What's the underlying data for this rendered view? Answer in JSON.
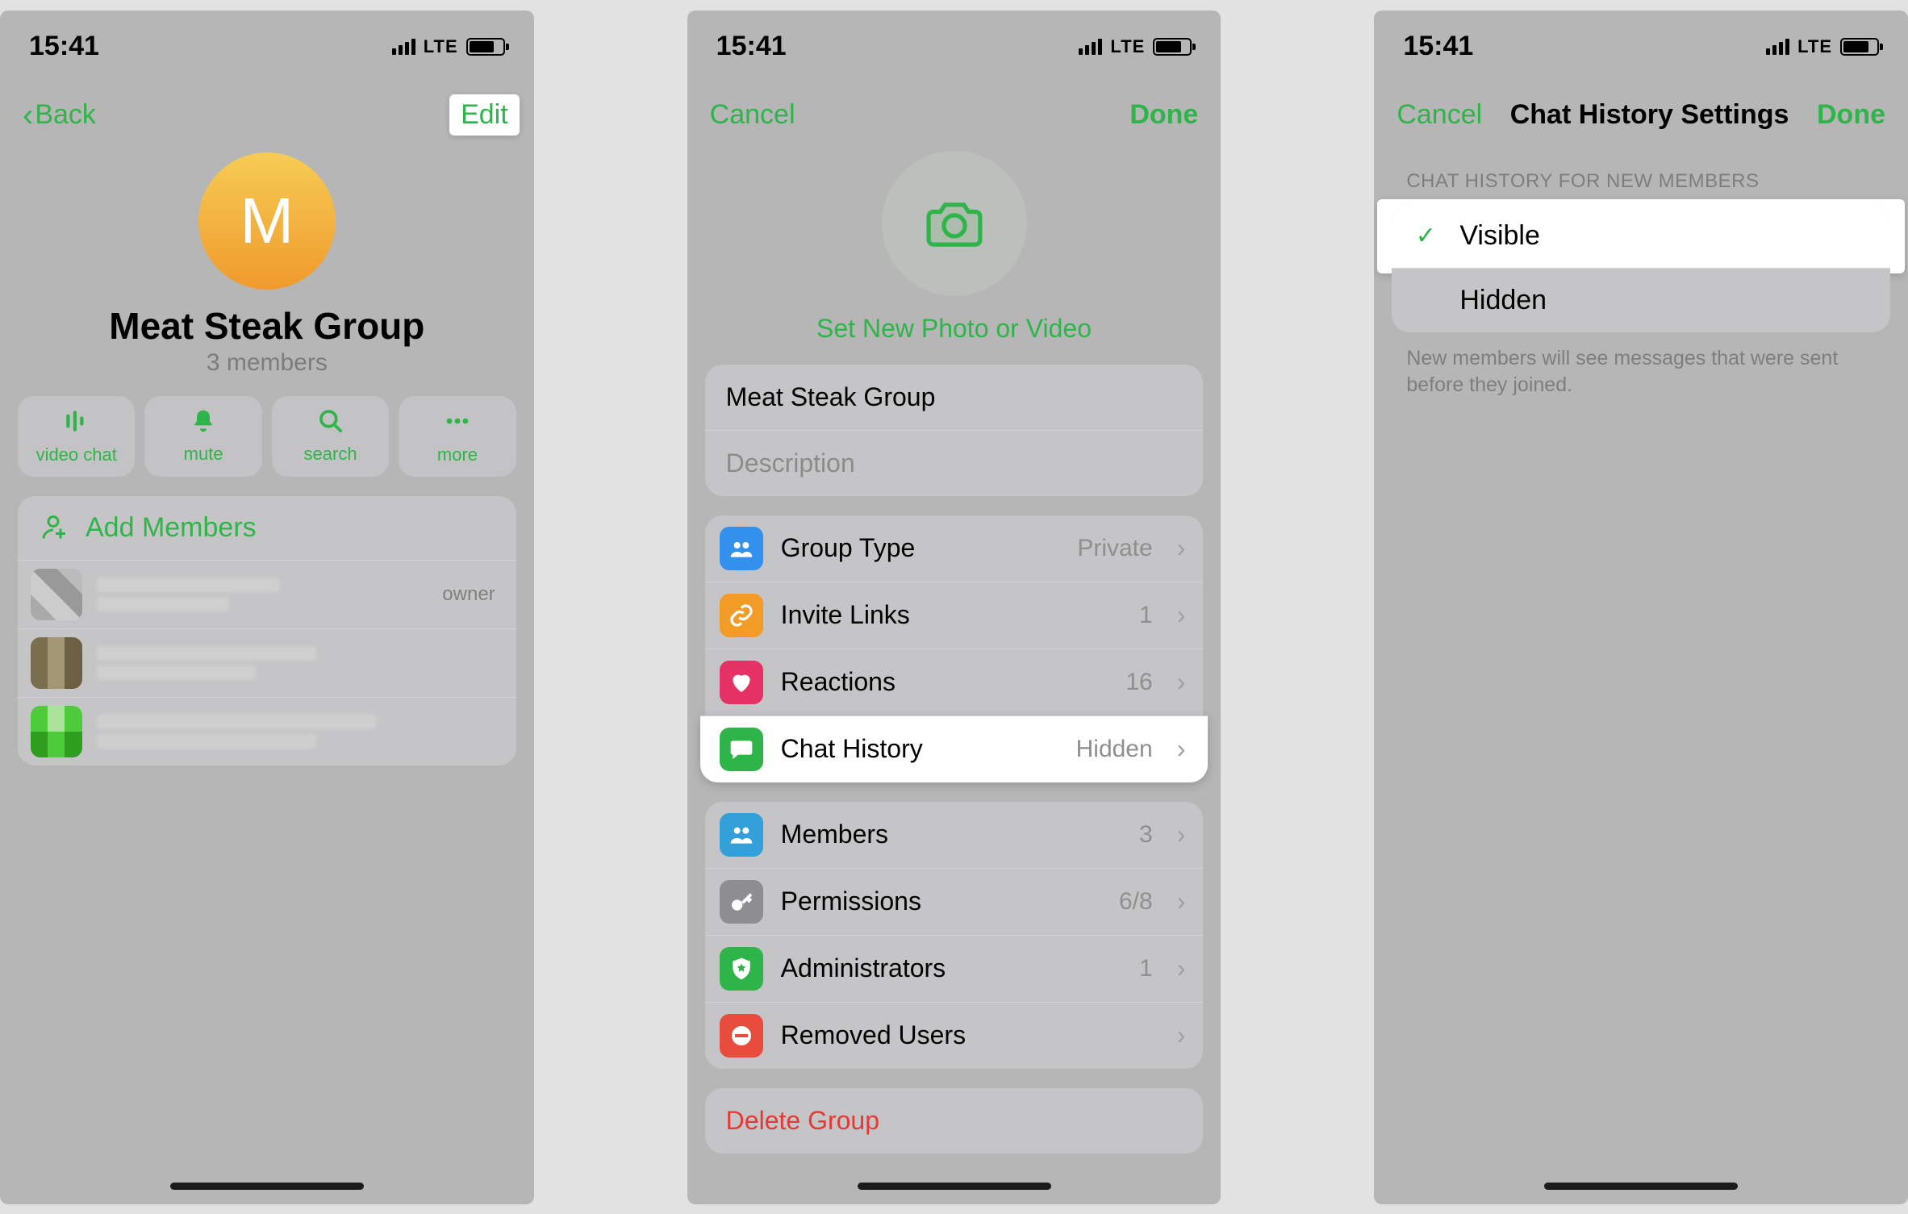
{
  "status": {
    "time": "15:41",
    "network": "LTE"
  },
  "screen1": {
    "back": "Back",
    "edit": "Edit",
    "avatar_letter": "M",
    "group_name": "Meat Steak Group",
    "member_count": "3 members",
    "actions": {
      "video_chat": "video chat",
      "mute": "mute",
      "search": "search",
      "more": "more"
    },
    "add_members": "Add Members",
    "owner_tag": "owner"
  },
  "screen2": {
    "cancel": "Cancel",
    "done": "Done",
    "set_photo": "Set New Photo or Video",
    "group_name": "Meat Steak Group",
    "description_placeholder": "Description",
    "rows": {
      "group_type": {
        "label": "Group Type",
        "value": "Private"
      },
      "invite_links": {
        "label": "Invite Links",
        "value": "1"
      },
      "reactions": {
        "label": "Reactions",
        "value": "16"
      },
      "chat_history": {
        "label": "Chat History",
        "value": "Hidden"
      },
      "members": {
        "label": "Members",
        "value": "3"
      },
      "permissions": {
        "label": "Permissions",
        "value": "6/8"
      },
      "administrators": {
        "label": "Administrators",
        "value": "1"
      },
      "removed_users": {
        "label": "Removed Users",
        "value": ""
      }
    },
    "delete_group": "Delete Group",
    "icon_colors": {
      "group_type": "#3390ec",
      "invite_links": "#f29b26",
      "reactions": "#e53163",
      "chat_history": "#2fb44a",
      "members": "#34a0d9",
      "permissions": "#8e8e92",
      "administrators": "#2fb44a",
      "removed_users": "#e74c3c"
    }
  },
  "screen3": {
    "cancel": "Cancel",
    "title": "Chat History Settings",
    "done": "Done",
    "section_header": "CHAT HISTORY FOR NEW MEMBERS",
    "options": {
      "visible": "Visible",
      "hidden": "Hidden"
    },
    "footer": "New members will see messages that were sent before they joined."
  }
}
